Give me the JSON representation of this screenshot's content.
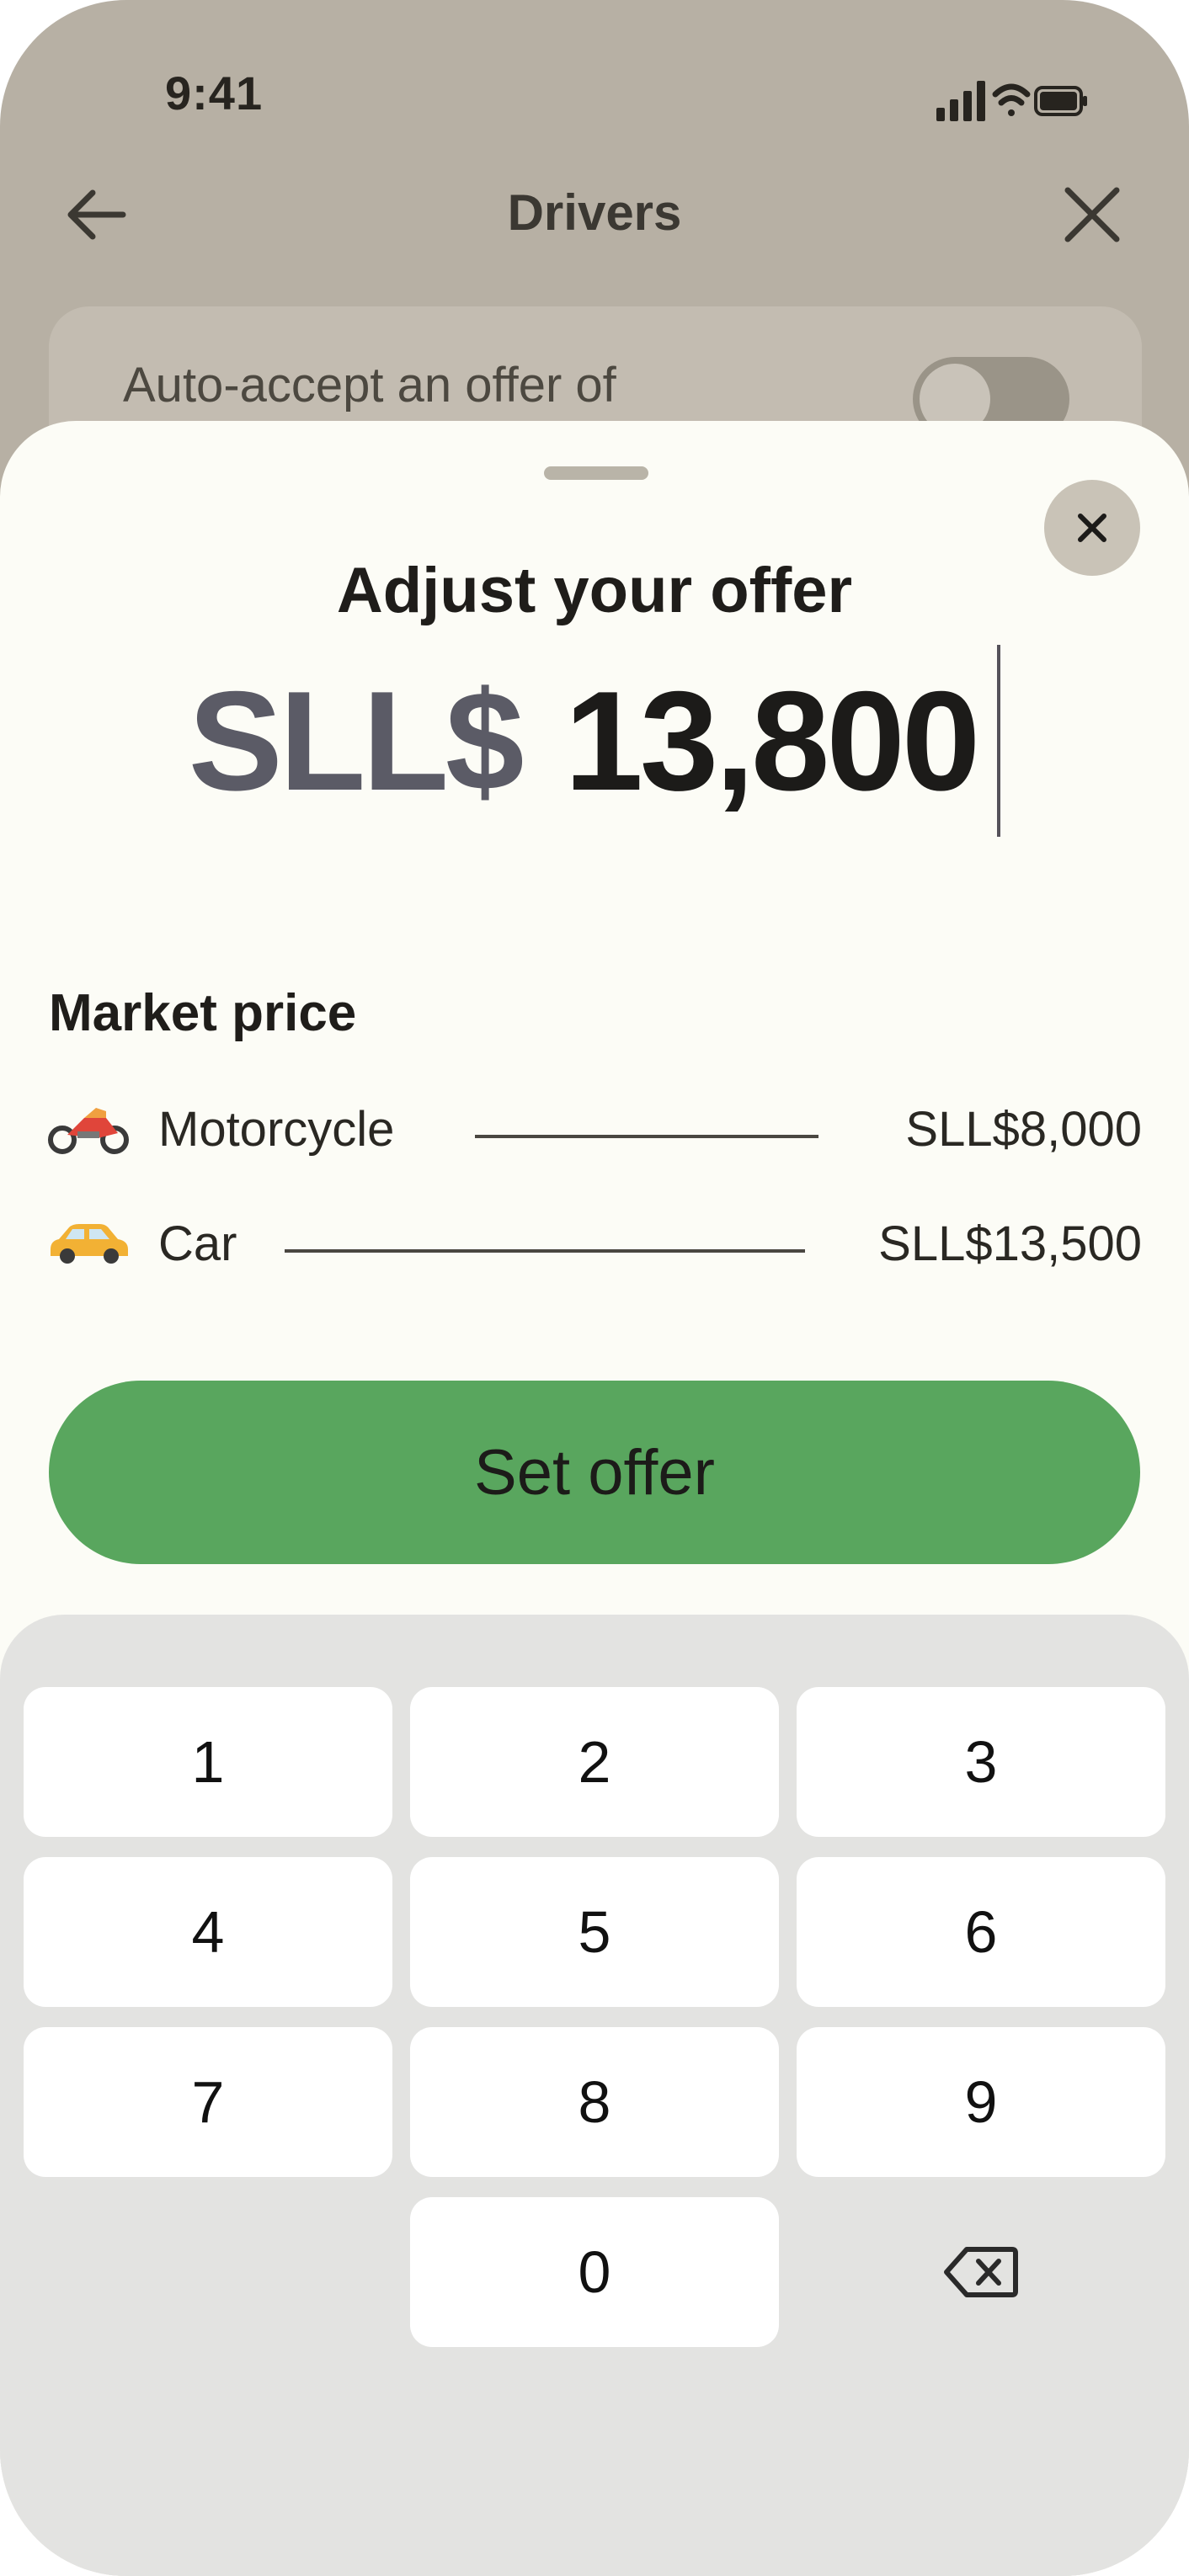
{
  "status_bar": {
    "time": "9:41",
    "icons": [
      "signal-icon",
      "wifi-icon",
      "battery-icon"
    ]
  },
  "nav": {
    "title": "Drivers",
    "back_icon": "arrow-left-icon",
    "close_icon": "close-icon"
  },
  "auto_accept": {
    "label": "Auto-accept an offer of",
    "enabled": false
  },
  "sheet": {
    "title": "Adjust your offer",
    "currency": "SLL$",
    "amount": "13,800",
    "market_title": "Market price",
    "market_rows": [
      {
        "icon": "motorcycle-icon",
        "name": "Motorcycle",
        "price": "SLL$8,000"
      },
      {
        "icon": "car-icon",
        "name": "Car",
        "price": "SLL$13,500"
      }
    ],
    "set_offer_label": "Set offer"
  },
  "keypad": {
    "keys": [
      "1",
      "2",
      "3",
      "4",
      "5",
      "6",
      "7",
      "8",
      "9",
      "0"
    ],
    "backspace_icon": "backspace-icon"
  },
  "colors": {
    "accent": "#59a65e",
    "sheet_bg": "#fcfcf6",
    "backdrop": "#b7b0a4",
    "keypad_bg": "#e3e3e1"
  }
}
